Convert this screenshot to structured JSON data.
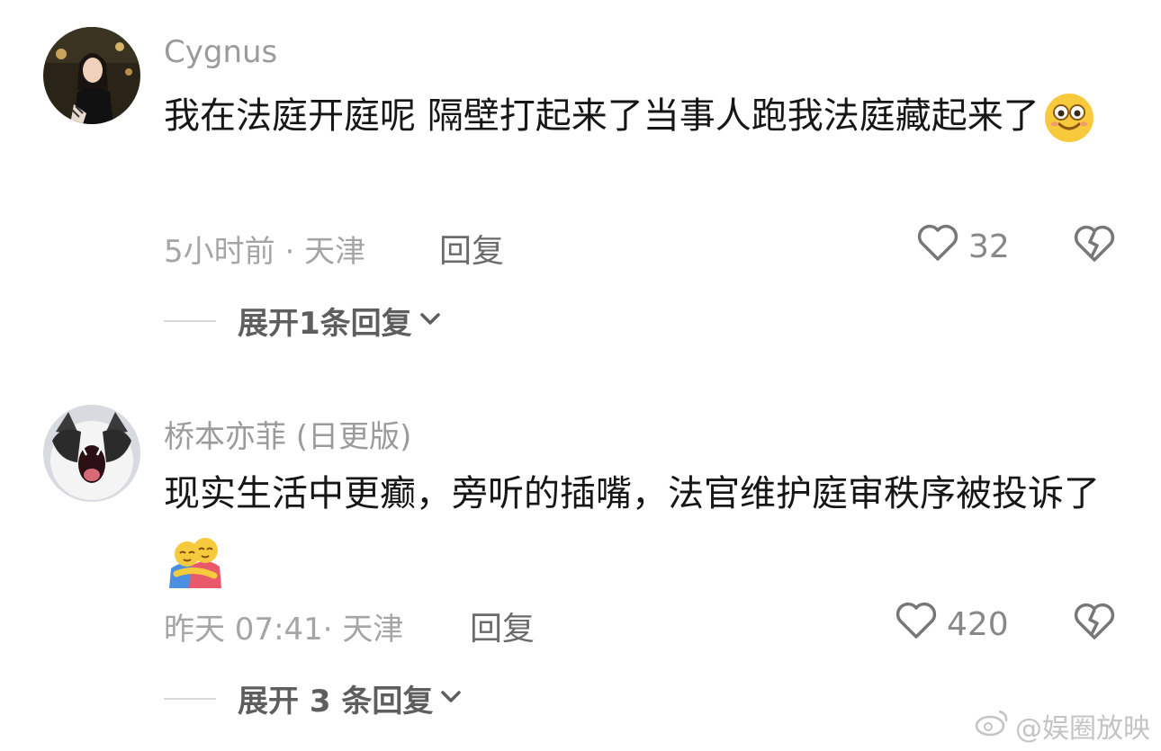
{
  "comments": [
    {
      "username": "Cygnus",
      "text": "我在法庭开庭呢 隔壁打起来了当事人跑我法庭藏起来了",
      "emoji": "grinning-face-emoji",
      "time": "5小时前",
      "location": "天津",
      "reply_label": "回复",
      "likes": "32",
      "expand_label": "展开1条回复"
    },
    {
      "username": "桥本亦菲 (日更版)",
      "text": "现实生活中更癫，旁听的插嘴，法官维护庭审秩序被投诉了",
      "emoji": "hugging-people-emoji",
      "time": "昨天 07:41",
      "location": "天津",
      "reply_label": "回复",
      "likes": "420",
      "expand_label": "展开 3 条回复"
    }
  ],
  "watermark": "@娱圈放映",
  "colors": {
    "text": "#161616",
    "muted": "#9b9b9b",
    "divider": "#d8d8d8"
  }
}
